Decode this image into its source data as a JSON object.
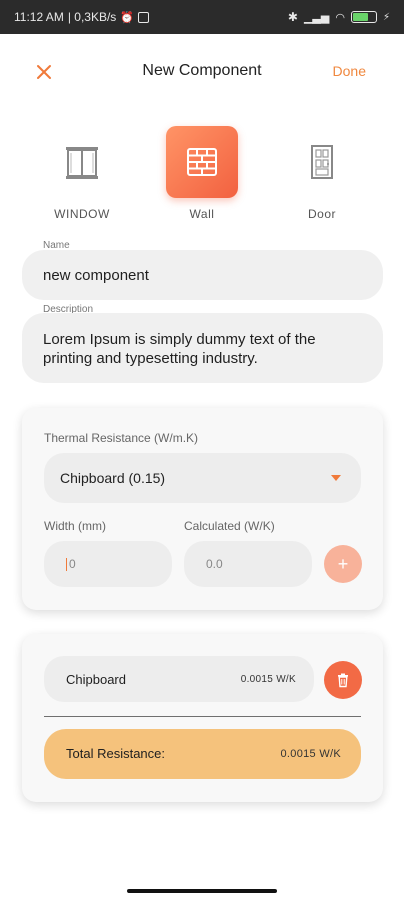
{
  "status_bar": {
    "time": "11:12 AM",
    "net_speed": "| 0,3KB/s"
  },
  "header": {
    "title": "New Component",
    "done_label": "Done",
    "close_icon": "close-icon"
  },
  "component_types": [
    {
      "label": "WINDOW",
      "icon": "window-icon",
      "active": false
    },
    {
      "label": "Wall",
      "icon": "brick-wall-icon",
      "active": true
    },
    {
      "label": "Door",
      "icon": "door-icon",
      "active": false
    }
  ],
  "form": {
    "name_label": "Name",
    "name_value": "new component",
    "description_label": "Description",
    "description_value": "Lorem Ipsum is simply dummy text of the printing and typesetting industry."
  },
  "thermal_card": {
    "label": "Thermal Resistance (W/m.K)",
    "selected_material": "Chipboard (0.15)",
    "width_label": "Width (mm)",
    "width_value": "0",
    "calculated_label": "Calculated (W/K)",
    "calculated_value": "0.0",
    "add_symbol": "+"
  },
  "layers_card": {
    "layers": [
      {
        "name": "Chipboard",
        "value": "0.0015 W/K"
      }
    ],
    "total_label": "Total Resistance:",
    "total_value": "0.0015 W/K"
  },
  "colors": {
    "accent": "#f07a3a",
    "accent_gradient_start": "#ff9466",
    "accent_gradient_end": "#f26140",
    "total_bar": "#f5c27c",
    "delete_button": "#f26a45"
  }
}
